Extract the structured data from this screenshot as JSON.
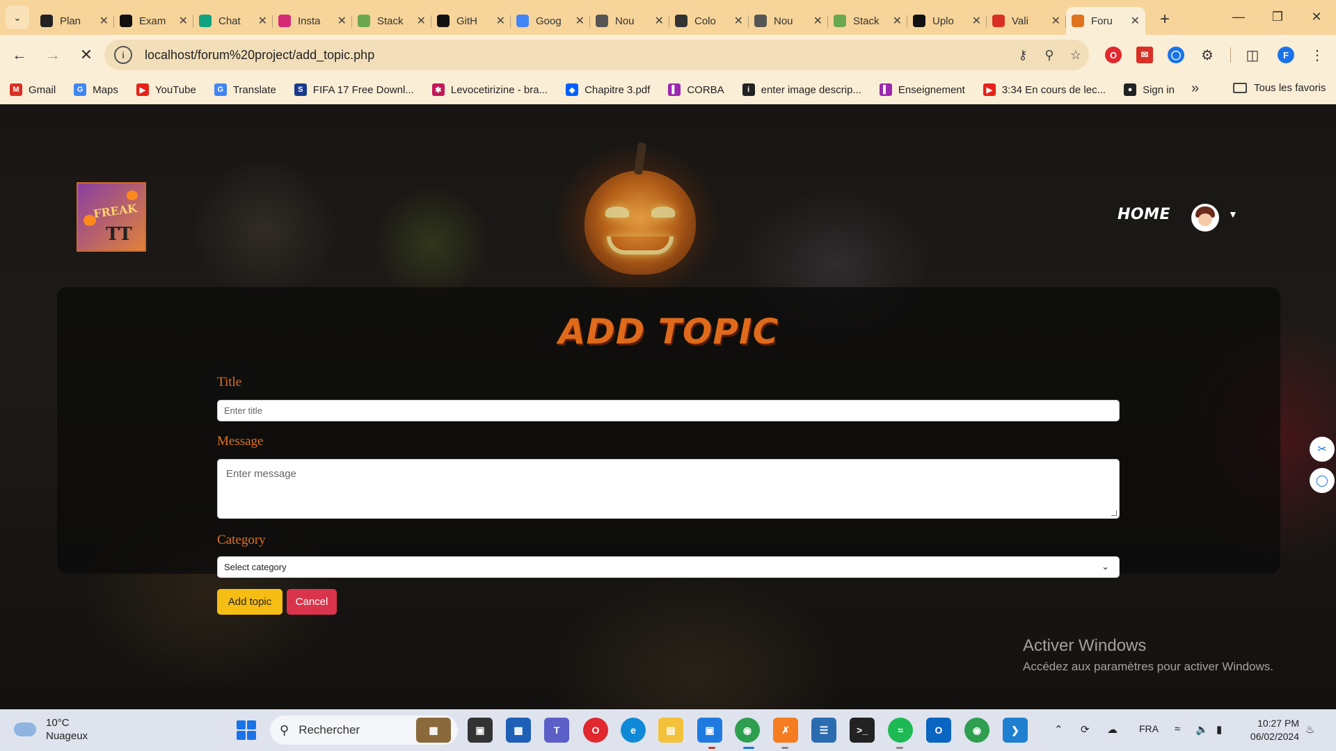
{
  "browser": {
    "tabs": [
      {
        "label": "Plan",
        "icon": "planner-icon",
        "color": "#222"
      },
      {
        "label": "Exam",
        "icon": "circle-icon",
        "color": "#111"
      },
      {
        "label": "Chat",
        "icon": "chatgpt-icon",
        "color": "#10a37f"
      },
      {
        "label": "Insta",
        "icon": "instagram-icon",
        "color": "#d62976"
      },
      {
        "label": "Stack",
        "icon": "stack-icon",
        "color": "#6aa84f"
      },
      {
        "label": "GitH",
        "icon": "github-icon",
        "color": "#111"
      },
      {
        "label": "Goog",
        "icon": "google-translate-icon",
        "color": "#4285f4"
      },
      {
        "label": "Nou",
        "icon": "chrome-icon",
        "color": "#555"
      },
      {
        "label": "Colo",
        "icon": "cup-icon",
        "color": "#333"
      },
      {
        "label": "Nou",
        "icon": "chrome-icon",
        "color": "#555"
      },
      {
        "label": "Stack",
        "icon": "stack-icon",
        "color": "#6aa84f"
      },
      {
        "label": "Uplo",
        "icon": "github-icon",
        "color": "#111"
      },
      {
        "label": "Vali",
        "icon": "gmail-icon",
        "color": "#d93025"
      },
      {
        "label": "Foru",
        "icon": "web-icon",
        "color": "#e0731e",
        "active": true
      }
    ],
    "url": "localhost/forum%20project/add_topic.php",
    "profile_initial": "F",
    "bookmarks": [
      {
        "label": "Gmail",
        "icon": "gmail-icon",
        "color": "#d93025",
        "glyph": "M"
      },
      {
        "label": "Maps",
        "icon": "google-icon",
        "color": "#4285f4",
        "glyph": "G"
      },
      {
        "label": "YouTube",
        "icon": "youtube-icon",
        "color": "#e62117",
        "glyph": "▶"
      },
      {
        "label": "Translate",
        "icon": "translate-icon",
        "color": "#4285f4",
        "glyph": "G"
      },
      {
        "label": "FIFA 17 Free Downl...",
        "icon": "s-icon",
        "color": "#1a3c8c",
        "glyph": "S"
      },
      {
        "label": "Levocetirizine - bra...",
        "icon": "molecule-icon",
        "color": "#c2185b",
        "glyph": "✱"
      },
      {
        "label": "Chapitre 3.pdf",
        "icon": "dropbox-icon",
        "color": "#0061fe",
        "glyph": "◆"
      },
      {
        "label": "CORBA",
        "icon": "page-icon",
        "color": "#9c27b0",
        "glyph": "▌"
      },
      {
        "label": "enter image descrip...",
        "icon": "info-icon",
        "color": "#222",
        "glyph": "i"
      },
      {
        "label": "Enseignement",
        "icon": "page-icon",
        "color": "#9c27b0",
        "glyph": "▌"
      },
      {
        "label": "3:34 En cours de lec...",
        "icon": "youtube-icon",
        "color": "#e62117",
        "glyph": "▶"
      },
      {
        "label": "Sign in",
        "icon": "github-icon",
        "color": "#222",
        "glyph": "●"
      }
    ],
    "all_bookmarks": "Tous les favoris"
  },
  "site": {
    "logo_text": "FREAK",
    "logo_mark": "TT",
    "nav_home": "HOME"
  },
  "form": {
    "title": "ADD TOPIC",
    "title_label": "Title",
    "title_placeholder": "Enter title",
    "message_label": "Message",
    "message_placeholder": "Enter message",
    "category_label": "Category",
    "category_selected": "Select category",
    "submit": "Add topic",
    "cancel": "Cancel"
  },
  "watermark": {
    "line1": "Activer Windows",
    "line2": "Accédez aux paramètres pour activer Windows."
  },
  "taskbar": {
    "temperature": "10°C",
    "weather": "Nuageux",
    "search": "Rechercher",
    "language": "FRA",
    "time": "10:27 PM",
    "date": "06/02/2024"
  }
}
